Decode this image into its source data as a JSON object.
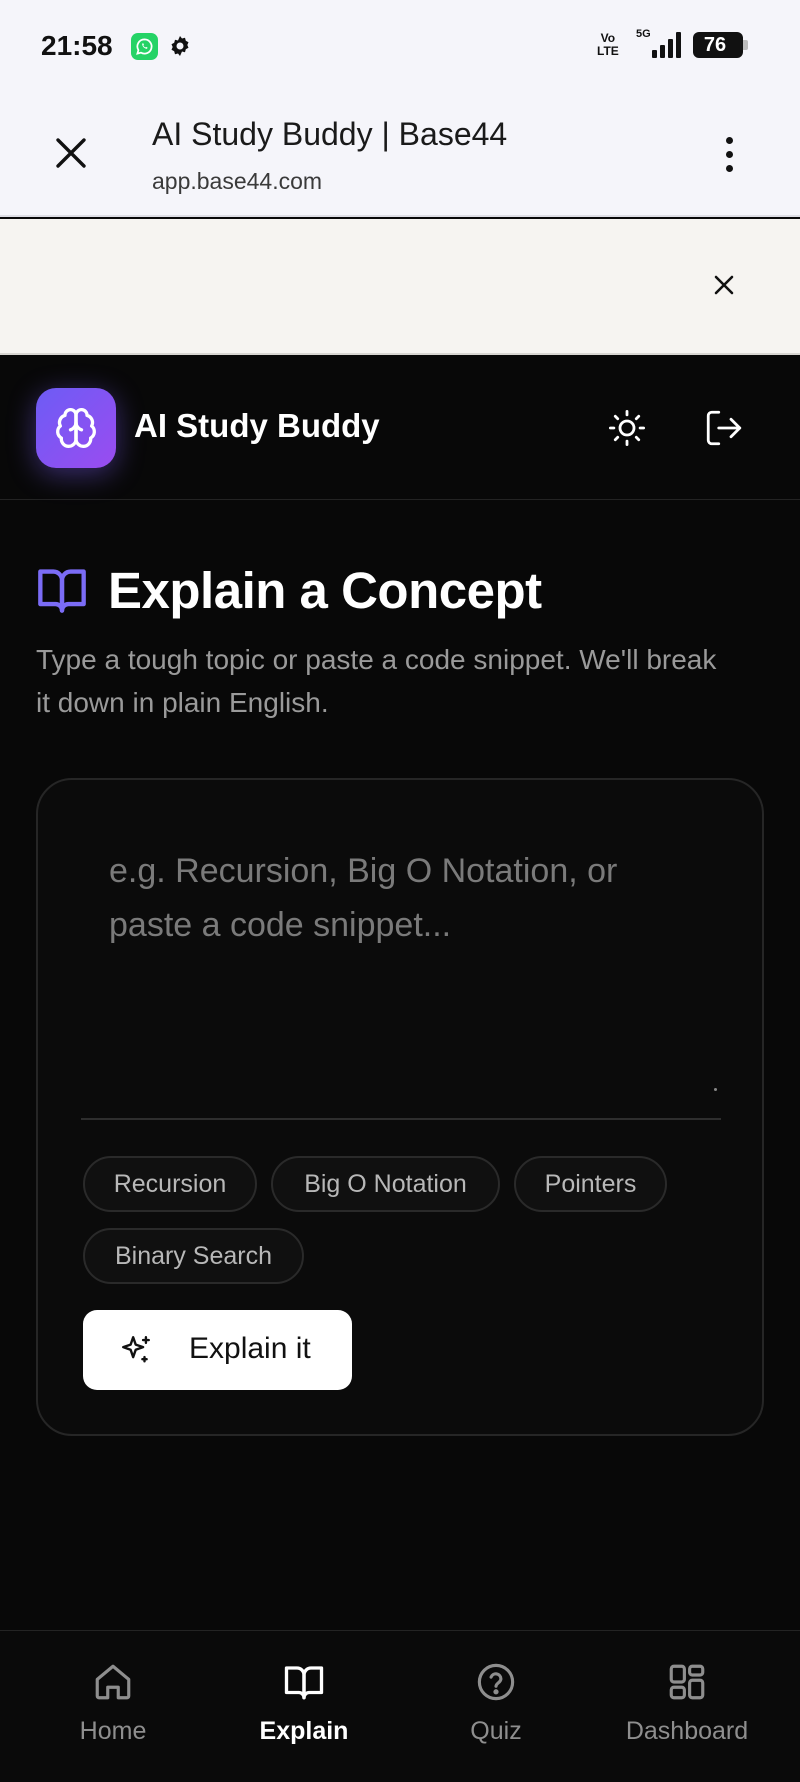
{
  "status_bar": {
    "time": "21:58",
    "volte_top": "Vo",
    "volte_bottom": "LTE",
    "network": "5G",
    "battery": "76"
  },
  "browser": {
    "title": "AI Study Buddy | Base44",
    "url": "app.base44.com"
  },
  "app": {
    "name": "AI Study Buddy",
    "accent_gradient": [
      "#6d5cf5",
      "#9a4cf0"
    ]
  },
  "main": {
    "title": "Explain a Concept",
    "description": "Type a tough topic or paste a code snippet. We'll break it down in plain English.",
    "input": {
      "value": "",
      "placeholder": "e.g. Recursion, Big O Notation, or paste a code snippet..."
    },
    "suggestions": [
      "Recursion",
      "Big O Notation",
      "Pointers",
      "Binary Search"
    ],
    "submit_label": "Explain it"
  },
  "nav": {
    "items": [
      {
        "label": "Home",
        "icon": "home-icon",
        "active": false
      },
      {
        "label": "Explain",
        "icon": "book-open-icon",
        "active": true
      },
      {
        "label": "Quiz",
        "icon": "question-circle-icon",
        "active": false
      },
      {
        "label": "Dashboard",
        "icon": "grid-icon",
        "active": false
      }
    ]
  }
}
